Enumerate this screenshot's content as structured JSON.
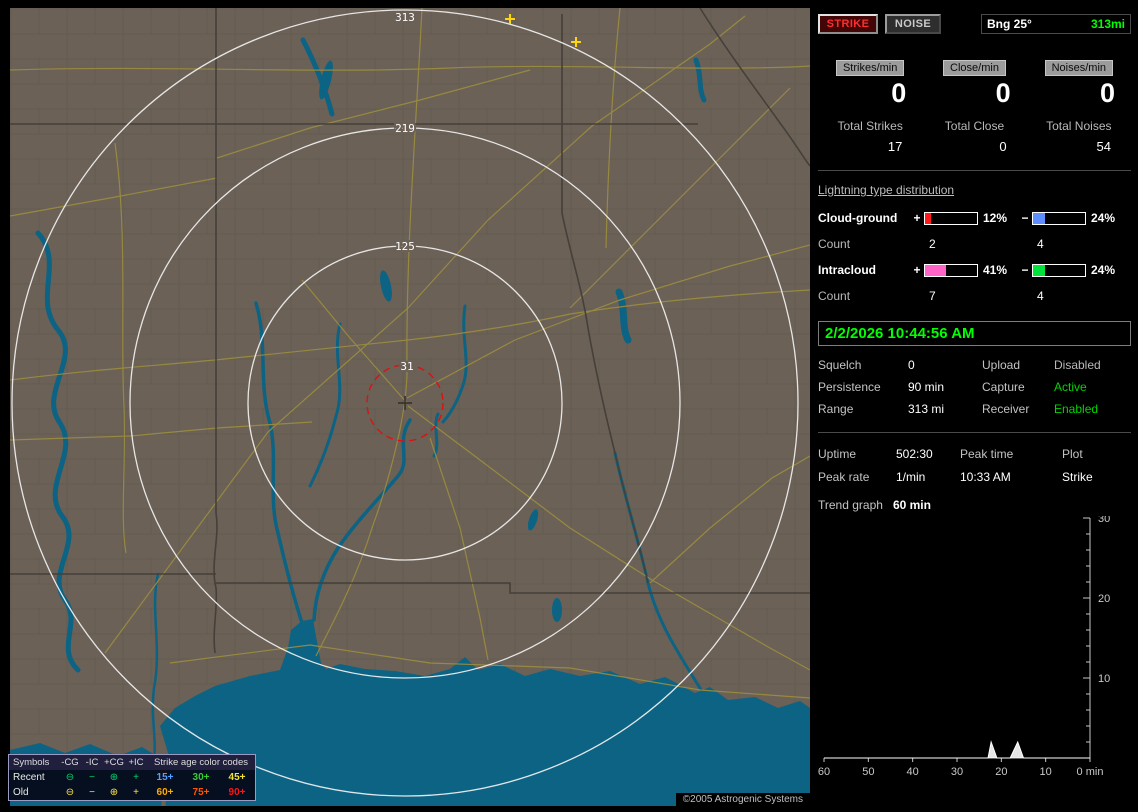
{
  "map": {
    "ring_labels": [
      "313",
      "219",
      "125",
      "31"
    ],
    "strike_markers": [
      {
        "x": 500,
        "y": 11
      },
      {
        "x": 566,
        "y": 34
      }
    ],
    "strike_marker_color": "#ffd60a",
    "copyright": "©2005 Astrogenic Systems",
    "legend": {
      "symbols_title": "Symbols",
      "col_headers": [
        "-CG",
        "-IC",
        "+CG",
        "+IC"
      ],
      "age_title": "Strike age color codes",
      "symbol_glyphs": [
        "⊖",
        "−",
        "⊕",
        "+"
      ],
      "rows": [
        {
          "label": "Recent",
          "symbol_color": "#00d26a",
          "ages": [
            {
              "text": "15+",
              "color": "#4da3ff"
            },
            {
              "text": "30+",
              "color": "#35cc35"
            },
            {
              "text": "45+",
              "color": "#f0e23a"
            }
          ]
        },
        {
          "label": "Old",
          "symbol_color": "#ffe34d",
          "ages": [
            {
              "text": "60+",
              "color": "#ffaa00"
            },
            {
              "text": "75+",
              "color": "#ff5500"
            },
            {
              "text": "90+",
              "color": "#ff1414"
            }
          ]
        }
      ]
    }
  },
  "panel": {
    "buttons": {
      "strike": "STRIKE",
      "noise": "NOISE"
    },
    "bearing": {
      "label": "Bng 25°",
      "range": "313mi",
      "range_color": "#00ff00"
    },
    "rates": [
      {
        "label": "Strikes/min",
        "value": "0"
      },
      {
        "label": "Close/min",
        "value": "0"
      },
      {
        "label": "Noises/min",
        "value": "0"
      }
    ],
    "totals": [
      {
        "label": "Total Strikes",
        "value": "17"
      },
      {
        "label": "Total Close",
        "value": "0"
      },
      {
        "label": "Total Noises",
        "value": "54"
      }
    ],
    "distribution": {
      "title": "Lightning type distribution",
      "plus": "+",
      "minus": "−",
      "rows": [
        {
          "name": "Cloud-ground",
          "pos_pct": "12%",
          "pos_color": "#ff1a1a",
          "neg_pct": "24%",
          "neg_color": "#5e8dff",
          "count_label": "Count",
          "pos_count": "2",
          "neg_count": "4"
        },
        {
          "name": "Intracloud",
          "pos_pct": "41%",
          "pos_color": "#ff63c8",
          "neg_pct": "24%",
          "neg_color": "#00e13c",
          "count_label": "Count",
          "pos_count": "7",
          "neg_count": "4"
        }
      ]
    },
    "timestamp": "2/2/2026 10:44:56 AM",
    "timestamp_color": "#00ff00",
    "settings": [
      {
        "label": "Squelch",
        "value": "0",
        "label2": "Upload",
        "value2": "Disabled",
        "value2_color": "#b9b9b9"
      },
      {
        "label": "Persistence",
        "value": "90 min",
        "label2": "Capture",
        "value2": "Active",
        "value2_color": "#00d500"
      },
      {
        "label": "Range",
        "value": "313 mi",
        "label2": "Receiver",
        "value2": "Enabled",
        "value2_color": "#00d500"
      }
    ],
    "stats2": {
      "uptime_label": "Uptime",
      "uptime_value": "502:30",
      "peaktime_label": "Peak time",
      "plot_label": "Plot",
      "peakrate_label": "Peak rate",
      "peakrate_value": "1/min",
      "peaktime_value": "10:33 AM",
      "plot_value": "Strike"
    },
    "trend": {
      "label": "Trend graph",
      "value": "60 min"
    }
  },
  "chart_data": {
    "type": "line",
    "title": "Trend graph (strikes per minute, last 60 min)",
    "xlabel": "min",
    "ylabel": "",
    "ylim": [
      0,
      30
    ],
    "x_ticks": [
      60,
      50,
      40,
      30,
      20,
      10,
      0
    ],
    "y_ticks": [
      10,
      20,
      30
    ],
    "grid": false,
    "legend_position": "none",
    "axis_color": "#c8c8c8",
    "series": [
      {
        "name": "Strike",
        "color": "#ffffff",
        "points": [
          [
            60,
            0
          ],
          [
            26,
            0
          ],
          [
            23,
            0
          ],
          [
            22.3,
            2
          ],
          [
            21,
            0
          ],
          [
            18,
            0
          ],
          [
            16.3,
            2
          ],
          [
            15,
            0
          ],
          [
            0,
            0
          ]
        ]
      }
    ]
  }
}
